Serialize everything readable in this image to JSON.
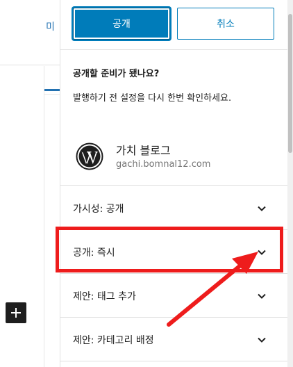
{
  "editor": {
    "preview_label": "미",
    "inserter_icon": "plus-icon"
  },
  "publish_panel": {
    "publish_label": "공개",
    "cancel_label": "취소",
    "ready_title": "공개할 준비가 됐나요?",
    "ready_description": "발행하기 전 설정을 다시 한번 확인하세요.",
    "site": {
      "logo_icon": "wordpress-logo-icon",
      "name": "가치 블로그",
      "url": "gachi.bomnal12.com"
    },
    "settings": [
      {
        "label": "가시성: 공개",
        "icon": "chevron-down-icon"
      },
      {
        "label": "공개: 즉시",
        "icon": "chevron-down-icon"
      },
      {
        "label": "제안: 태그 추가",
        "icon": "chevron-down-icon"
      },
      {
        "label": "제안: 카테고리 배정",
        "icon": "chevron-down-icon"
      }
    ]
  },
  "annotation": {
    "highlight_color": "#ee1c1c",
    "highlighted_setting": "공개: 즉시"
  },
  "colors": {
    "accent": "#007cba",
    "text": "#1e1e1e",
    "muted": "#757575",
    "divider": "#e0e0e0"
  }
}
